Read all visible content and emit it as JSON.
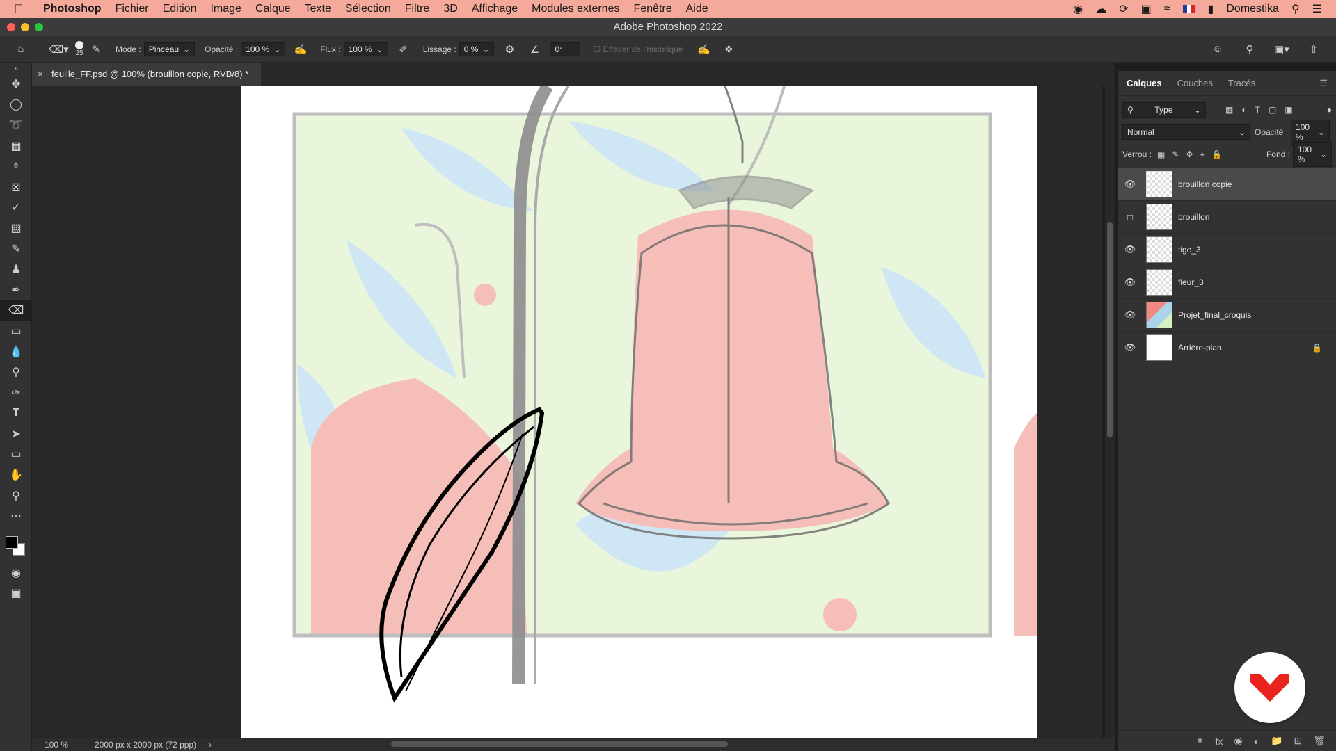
{
  "menubar": {
    "app": "Photoshop",
    "items": [
      "Fichier",
      "Edition",
      "Image",
      "Calque",
      "Texte",
      "Sélection",
      "Filtre",
      "3D",
      "Affichage",
      "Modules externes",
      "Fenêtre",
      "Aide"
    ],
    "user": "Domestika"
  },
  "window": {
    "title": "Adobe Photoshop 2022"
  },
  "options": {
    "brush_size": "25",
    "mode_label": "Mode :",
    "mode_value": "Pinceau",
    "opacity_label": "Opacité :",
    "opacity_value": "100 %",
    "flow_label": "Flux :",
    "flow_value": "100 %",
    "smoothing_label": "Lissage :",
    "smoothing_value": "0 %",
    "angle_value": "0°",
    "history_label": "Effacer de l'historique"
  },
  "document": {
    "tab_title": "feuille_FF.psd @ 100% (brouillon copie, RVB/8) *"
  },
  "status": {
    "zoom": "100 %",
    "doc_info": "2000 px x 2000 px (72 ppp)"
  },
  "layers_panel": {
    "tabs": [
      "Calques",
      "Couches",
      "Tracés"
    ],
    "filter_type": "Type",
    "blend_mode": "Normal",
    "opacity_label": "Opacité :",
    "opacity_value": "100 %",
    "lock_label": "Verrou :",
    "fill_label": "Fond :",
    "fill_value": "100 %",
    "layers": [
      {
        "name": "brouillon copie",
        "visible": true,
        "selected": true
      },
      {
        "name": "brouillon",
        "visible": false,
        "selected": false
      },
      {
        "name": "tige_3",
        "visible": true,
        "selected": false
      },
      {
        "name": "fleur_3",
        "visible": true,
        "selected": false
      },
      {
        "name": "Projet_final_croquis",
        "visible": true,
        "selected": false
      },
      {
        "name": "Arrière-plan",
        "visible": true,
        "selected": false,
        "locked": true
      }
    ]
  },
  "colors": {
    "menubar": "#f5a99a",
    "accent_red": "#e8241c",
    "flower_red": "#f08a80",
    "leaf_blue": "#a9d4ec",
    "leaf_green": "#d8efc0"
  }
}
